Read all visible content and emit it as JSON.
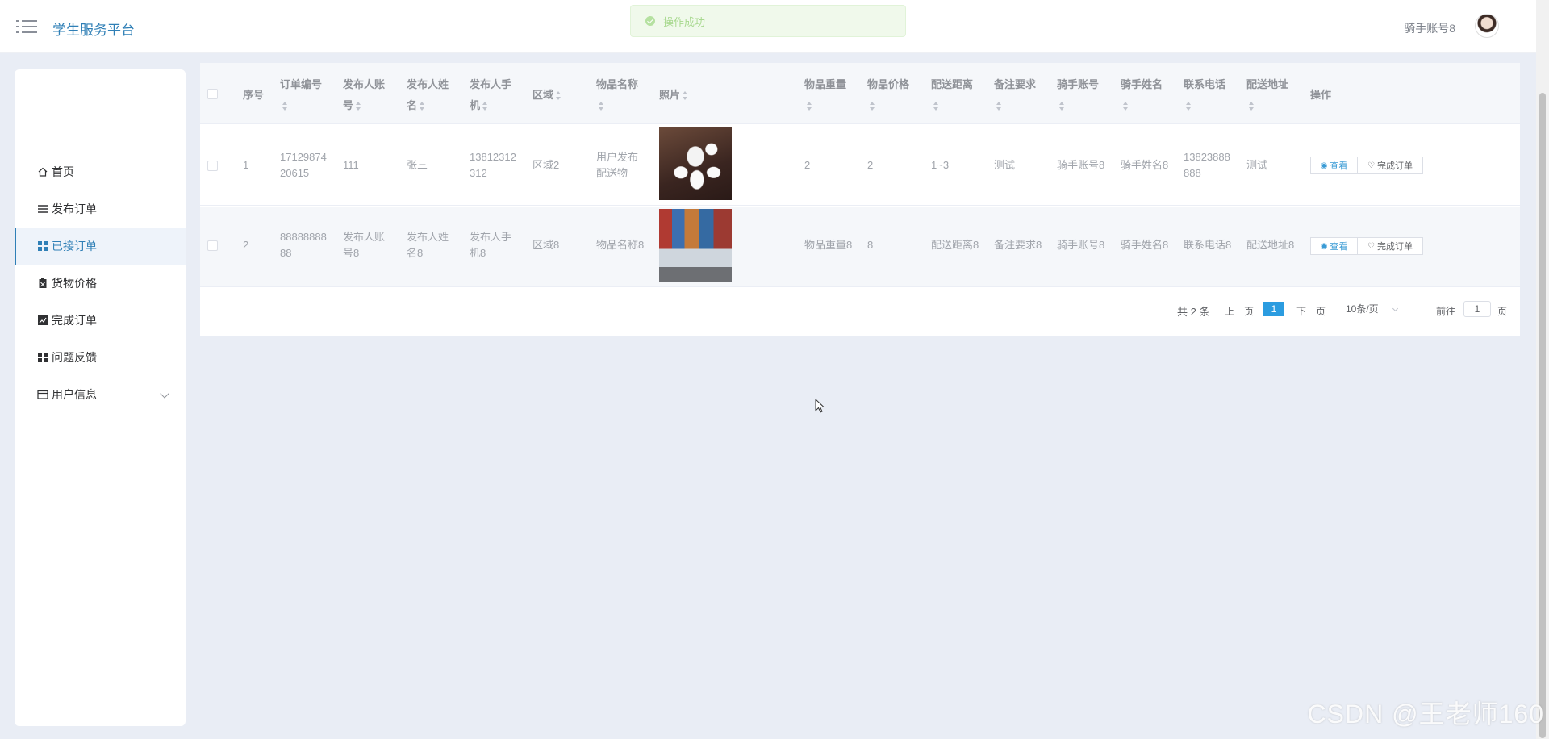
{
  "header": {
    "app_title": "学生服务平台",
    "user_name": "骑手账号8",
    "toast": "操作成功"
  },
  "sidebar": {
    "items": [
      {
        "label": "首页",
        "icon": "home-icon"
      },
      {
        "label": "发布订单",
        "icon": "list-icon"
      },
      {
        "label": "已接订单",
        "icon": "grid-icon"
      },
      {
        "label": "货物价格",
        "icon": "clipboard-icon"
      },
      {
        "label": "完成订单",
        "icon": "chart-icon"
      },
      {
        "label": "问题反馈",
        "icon": "grid-icon"
      },
      {
        "label": "用户信息",
        "icon": "card-icon"
      }
    ],
    "active_index": 2
  },
  "table": {
    "headers": {
      "index": "序号",
      "order_no_1": "订单编号",
      "publisher_account_1": "发布人账",
      "publisher_account_2": "号",
      "publisher_name_1": "发布人姓",
      "publisher_name_2": "名",
      "publisher_phone_1": "发布人手",
      "publisher_phone_2": "机",
      "region": "区域",
      "item_name": "物品名称",
      "photo": "照片",
      "weight": "物品重量",
      "price": "物品价格",
      "distance": "配送距离",
      "remark": "备注要求",
      "rider_account": "骑手账号",
      "rider_name": "骑手姓名",
      "contact_phone": "联系电话",
      "address": "配送地址",
      "actions": "操作"
    },
    "rows": [
      {
        "index": "1",
        "order_no_1": "17129874",
        "order_no_2": "20615",
        "publisher_account": "111",
        "publisher_name": "张三",
        "publisher_phone_1": "13812312",
        "publisher_phone_2": "312",
        "region": "区域2",
        "item_name_1": "用户发布",
        "item_name_2": "配送物",
        "weight": "2",
        "price": "2",
        "distance": "1~3",
        "remark": "测试",
        "rider_account": "骑手账号8",
        "rider_name": "骑手姓名8",
        "contact_phone_1": "13823888",
        "contact_phone_2": "888",
        "address": "测试"
      },
      {
        "index": "2",
        "order_no_1": "88888888",
        "order_no_2": "88",
        "publisher_account_1": "发布人账",
        "publisher_account_2": "号8",
        "publisher_name_1": "发布人姓",
        "publisher_name_2": "名8",
        "publisher_phone_1": "发布人手",
        "publisher_phone_2": "机8",
        "region": "区域8",
        "item_name": "物品名称8",
        "weight": "物品重量8",
        "price": "8",
        "distance": "配送距离8",
        "remark": "备注要求8",
        "rider_account": "骑手账号8",
        "rider_name": "骑手姓名8",
        "contact_phone": "联系电话8",
        "address": "配送地址8"
      }
    ],
    "view_label": "查看",
    "complete_label": "完成订单"
  },
  "pagination": {
    "total": "共 2 条",
    "prev": "上一页",
    "current": "1",
    "next": "下一页",
    "page_size": "10条/页",
    "goto_label": "前往",
    "goto_value": "1",
    "page_suffix": "页"
  },
  "watermark": "CSDN @王老师160"
}
